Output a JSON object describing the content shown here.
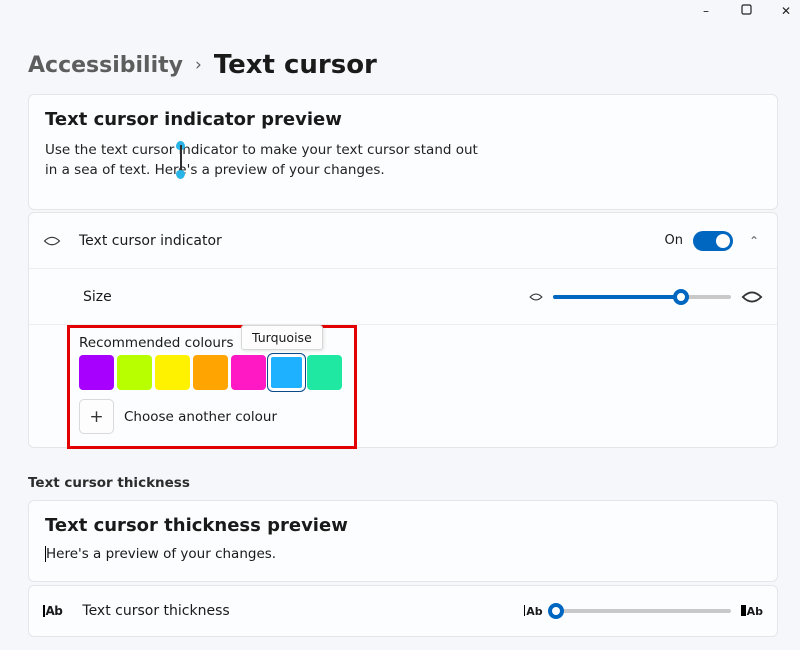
{
  "breadcrumb": {
    "parent": "Accessibility",
    "current": "Text cursor"
  },
  "preview1": {
    "heading": "Text cursor indicator preview",
    "line1": "Use the text cursor indicator to make your text cursor stand out",
    "line2": "in a sea of text. Here's a preview of your changes."
  },
  "indicator": {
    "label": "Text cursor indicator",
    "state_text": "On",
    "enabled": true,
    "size_label": "Size",
    "size_percent": 72
  },
  "colours": {
    "heading": "Recommended colours",
    "tooltip": "Turquoise",
    "swatches": [
      {
        "name": "purple",
        "hex": "#a700ff"
      },
      {
        "name": "lime",
        "hex": "#b8ff00"
      },
      {
        "name": "yellow",
        "hex": "#fff200"
      },
      {
        "name": "orange",
        "hex": "#ffa400"
      },
      {
        "name": "magenta",
        "hex": "#ff19c4"
      },
      {
        "name": "turquoise",
        "hex": "#1eb1ff",
        "selected": true
      },
      {
        "name": "mint",
        "hex": "#1fe8a3"
      }
    ],
    "add_label": "Choose another colour"
  },
  "section2_heading": "Text cursor thickness",
  "preview2": {
    "heading": "Text cursor thickness preview",
    "text": "Here's a preview of your changes."
  },
  "thickness_row": {
    "label": "Text cursor thickness",
    "percent": 2
  }
}
